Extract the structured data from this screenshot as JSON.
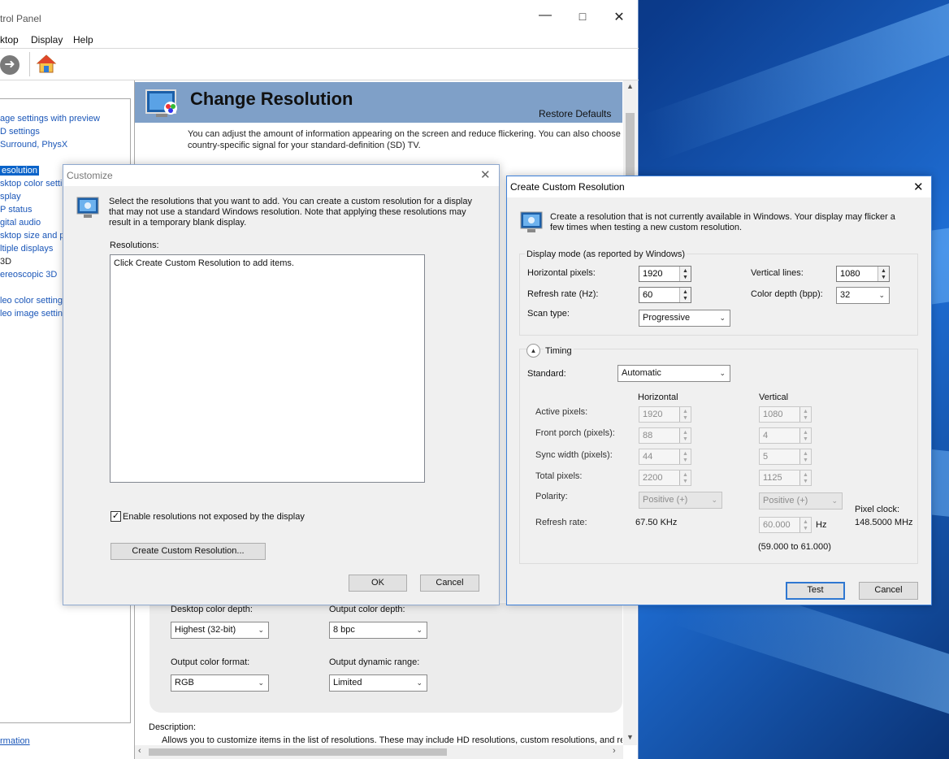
{
  "main_window": {
    "title": "trol Panel",
    "menu": [
      "ktop",
      "Display",
      "Help"
    ],
    "nav_items": [
      "age settings with preview",
      "D settings",
      " Surround, PhysX",
      "esolution",
      "sktop color setti",
      "splay",
      "P status",
      "gital audio",
      "sktop size and p",
      "ltiple displays",
      "3D",
      "ereoscopic 3D",
      "leo color setting",
      "leo image setting"
    ],
    "nav_selected_index": 3,
    "nav_footer_link": "rmation",
    "page_title": "Change Resolution",
    "restore_defaults": "Restore Defaults",
    "intro_text": "You can adjust the amount of information appearing on the screen and reduce flickering. You can also choose the",
    "intro_text2": "country-specific signal for your standard-definition (SD) TV.",
    "desktop_color_depth_label": "Desktop color depth:",
    "desktop_color_depth_value": "Highest (32-bit)",
    "output_color_depth_label": "Output color depth:",
    "output_color_depth_value": "8 bpc",
    "output_color_format_label": "Output color format:",
    "output_color_format_value": "RGB",
    "output_dynamic_range_label": "Output dynamic range:",
    "output_dynamic_range_value": "Limited",
    "description_label": "Description:",
    "description_text": "Allows you to customize items in the list of resolutions. These may include HD resolutions, custom resolutions, and reso"
  },
  "customize_dialog": {
    "title": "Customize",
    "info": "Select the resolutions that you want to add. You can create a custom resolution for a display",
    "info2": "that may not use a standard Windows resolution. Note that applying these resolutions may",
    "info3": "result in a temporary blank display.",
    "resolutions_label": "Resolutions:",
    "list_placeholder": "Click Create Custom Resolution to add items.",
    "checkbox_label": "Enable resolutions not exposed by the display",
    "checkbox_checked": true,
    "create_button": "Create Custom Resolution...",
    "ok_button": "OK",
    "cancel_button": "Cancel"
  },
  "create_dialog": {
    "title": "Create Custom Resolution",
    "info": "Create a resolution that is not currently available in Windows. Your display may flicker a",
    "info2": "few times when testing a new custom resolution.",
    "display_mode_label": "Display mode (as reported by Windows)",
    "horizontal_pixels_label": "Horizontal pixels:",
    "horizontal_pixels_value": "1920",
    "vertical_lines_label": "Vertical lines:",
    "vertical_lines_value": "1080",
    "refresh_rate_label": "Refresh rate (Hz):",
    "refresh_rate_value": "60",
    "color_depth_label": "Color depth (bpp):",
    "color_depth_value": "32",
    "scan_type_label": "Scan type:",
    "scan_type_value": "Progressive",
    "timing_label": "Timing",
    "standard_label": "Standard:",
    "standard_value": "Automatic",
    "col_horizontal": "Horizontal",
    "col_vertical": "Vertical",
    "rows": [
      {
        "label": "Active pixels:",
        "h": "1920",
        "v": "1080"
      },
      {
        "label": "Front porch (pixels):",
        "h": "88",
        "v": "4"
      },
      {
        "label": "Sync width (pixels):",
        "h": "44",
        "v": "5"
      },
      {
        "label": "Total pixels:",
        "h": "2200",
        "v": "1125"
      }
    ],
    "polarity_label": "Polarity:",
    "polarity_h": "Positive (+)",
    "polarity_v": "Positive (+)",
    "refresh_rate_row_label": "Refresh rate:",
    "refresh_rate_h": "67.50 KHz",
    "refresh_rate_v": "60.000",
    "hz_unit": "Hz",
    "refresh_range": "(59.000 to 61.000)",
    "pixel_clock_label": "Pixel clock:",
    "pixel_clock_value": "148.5000 MHz",
    "test_button": "Test",
    "cancel_button": "Cancel"
  },
  "colors": {
    "nav_link": "#1a56b8",
    "nav_selected": "#0a63c9",
    "banner": "#7fa0c8",
    "default_button_border": "#2f77d1"
  }
}
